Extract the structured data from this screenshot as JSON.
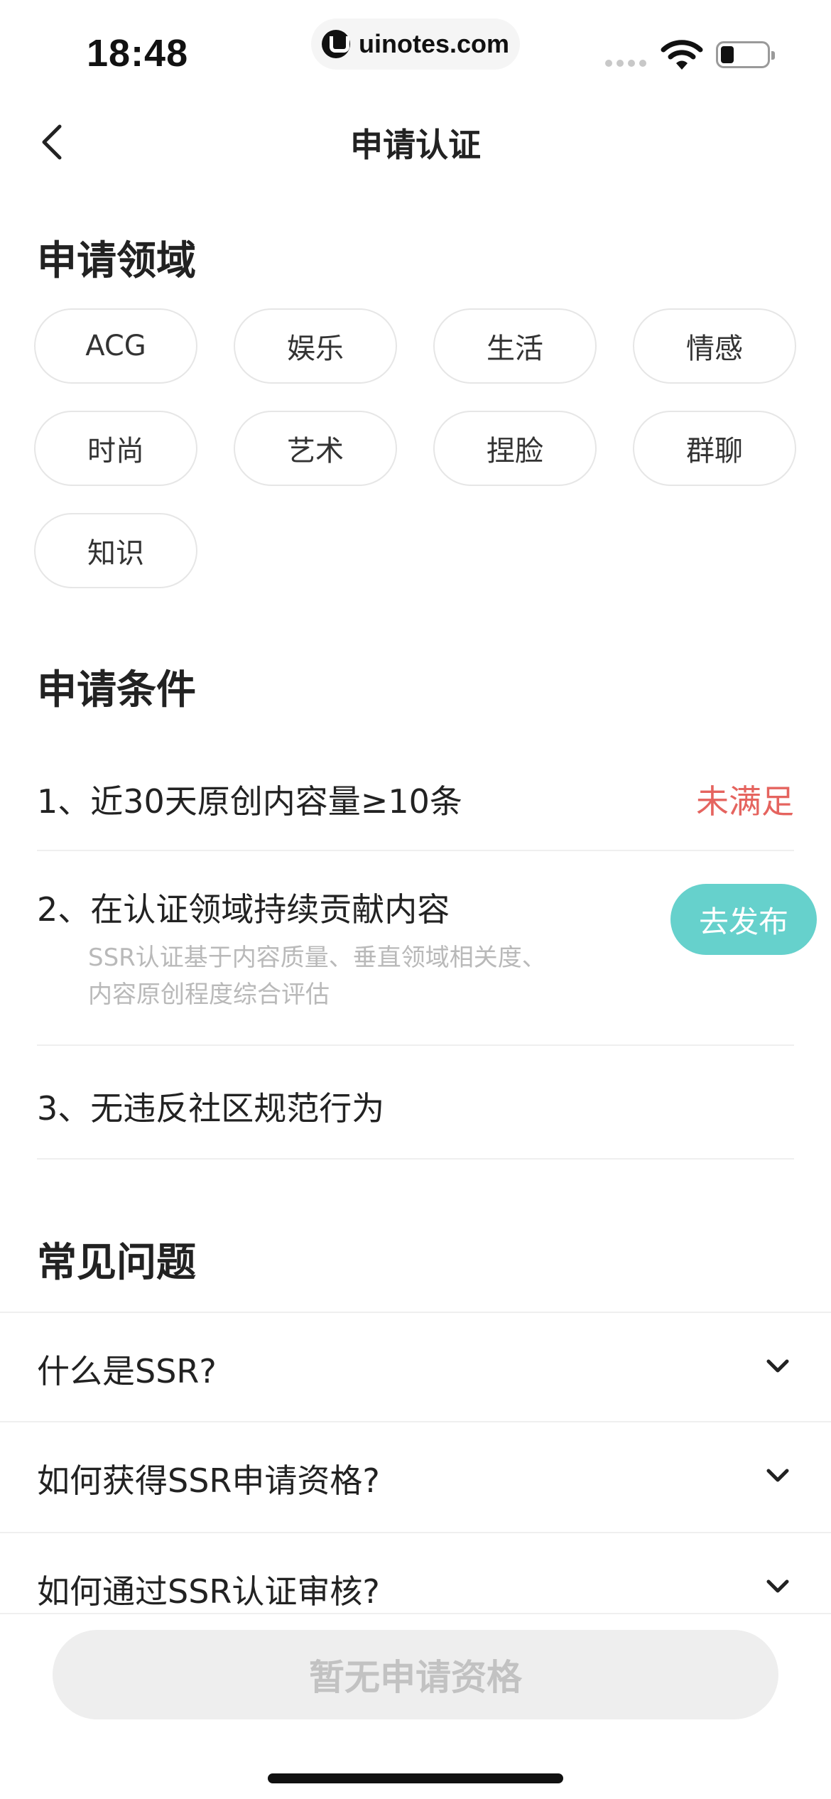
{
  "status_bar": {
    "time": "18:48",
    "url": "uinotes.com",
    "icons": [
      "signal-icon",
      "wifi-icon",
      "battery-icon"
    ]
  },
  "nav": {
    "title": "申请认证",
    "back_icon": "chevron-left-icon"
  },
  "domain_section": {
    "title": "申请领域",
    "tags": [
      "ACG",
      "娱乐",
      "生活",
      "情感",
      "时尚",
      "艺术",
      "捏脸",
      "群聊",
      "知识"
    ]
  },
  "conditions_section": {
    "title": "申请条件",
    "items": [
      {
        "text": "1、近30天原创内容量≥10条",
        "status": "未满足"
      },
      {
        "text": "2、在认证领域持续贡献内容",
        "sub_line1": "SSR认证基于内容质量、垂直领域相关度、",
        "sub_line2": "内容原创程度综合评估",
        "action": "去发布"
      },
      {
        "text": "3、无违反社区规范行为"
      }
    ]
  },
  "faq_section": {
    "title": "常见问题",
    "items": [
      "什么是SSR?",
      "如何获得SSR申请资格?",
      "如何通过SSR认证审核?"
    ]
  },
  "footer": {
    "button_label": "暂无申请资格"
  },
  "colors": {
    "accent": "#66d1cc",
    "unmet": "#e5645f",
    "disabled_bg": "#eeeeee",
    "disabled_text": "#c2c2c2"
  }
}
